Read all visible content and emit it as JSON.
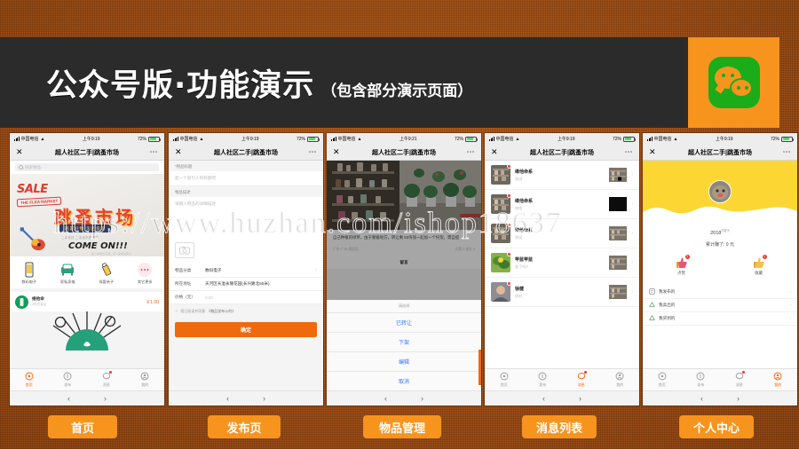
{
  "header": {
    "title": "公众号版·功能演示",
    "subtitle": "（包含部分演示页面）",
    "logo_icon": "wechat-logo-icon"
  },
  "watermark": {
    "text": "https://www.huzhan.com/ishop18637"
  },
  "statusbar": {
    "carrier": "中国电信",
    "wifi_icon": "wifi-icon",
    "time": "上午9:19",
    "time_alt": "上午9:21",
    "battery_pct": "72%"
  },
  "navbar": {
    "title": "超人社区二手|跳蚤市场",
    "close_icon": "close-icon",
    "more_icon": "more-dots-icon"
  },
  "tabbar": {
    "items": [
      {
        "label": "首页",
        "icon": "home-icon"
      },
      {
        "label": "发布",
        "icon": "publish-icon"
      },
      {
        "label": "消息",
        "icon": "message-icon"
      },
      {
        "label": "我的",
        "icon": "profile-icon"
      }
    ]
  },
  "wxbar": {
    "back_icon": "chevron-left-icon",
    "forward_icon": "chevron-right-icon"
  },
  "phone1": {
    "search_placeholder": "搜索物品",
    "search_icon": "search-icon",
    "banner": {
      "sale": "SALE",
      "flea": "THE FLEA MARKET",
      "cn_title": "跳蚤市场",
      "cn_sub": "闲置好物 淘回家吧",
      "small_note": "二手也好 二手也不要紧吧",
      "come_on": "COME ON!!!",
      "bottom_note": "废了的成色不错，有个充电说明书"
    },
    "categories": [
      {
        "label": "数码电子",
        "icon": "phone-icon"
      },
      {
        "label": "家私家电",
        "icon": "sofa-icon"
      },
      {
        "label": "母婴亲子",
        "icon": "bottle-icon"
      },
      {
        "label": "其它更多",
        "icon": "more-icon"
      }
    ],
    "product": {
      "name": "维他命",
      "desc": "2件已卖出",
      "price": "￥1.00"
    }
  },
  "phone2": {
    "title_label": "*物品标题",
    "title_placeholder": "起一个吸引人的标题吧",
    "desc_label": "物品描述",
    "desc_placeholder": "请输入物品的详细描述",
    "photo_icon": "camera-icon",
    "rows": [
      {
        "key": "物品分类",
        "value": "数码电子",
        "chevron": "chevron-right-icon"
      },
      {
        "key": "所在地址",
        "value": "天河区长湴永隆花园(长兴路北50米)",
        "chevron": "chevron-right-icon"
      },
      {
        "key": "价格（元）",
        "value": "0.00",
        "chevron": ""
      }
    ],
    "agree_tick": "check-icon",
    "agree_text": "我已阅读并同意",
    "agree_link": "《物品发布公约》",
    "submit": "确定"
  },
  "phone3": {
    "post_text": "自己种植的绿草，由于要搬地方，转让剩 50块钱一起加一个托架，需自提",
    "meta_left": "广东·广州 奥园区",
    "meta_right": "点赞 2  留言 3",
    "sheet": {
      "behind_title": "留言",
      "head": "请选择",
      "options": [
        "已转让",
        "下架",
        "编辑",
        "取消"
      ]
    }
  },
  "phone4": {
    "messages": [
      {
        "name": "维他命系",
        "preview": "测试",
        "avatar": "avatar-shelf",
        "thumb": "thumb-shelf"
      },
      {
        "name": "维他命系",
        "preview": "哈哈",
        "avatar": "avatar-shelf",
        "thumb": "thumb-dark"
      },
      {
        "name": "维他命系",
        "preview": "测试",
        "avatar": "avatar-shelf",
        "thumb": "thumb-shelf"
      },
      {
        "name": "苹蓝苹蓝",
        "preview": "卖了吗?",
        "avatar": "avatar-plant",
        "thumb": "thumb-shelf"
      },
      {
        "name": "徐健",
        "preview": "你好",
        "avatar": "avatar-person",
        "thumb": "thumb-shelf"
      }
    ]
  },
  "phone5": {
    "name": "2018",
    "name_sup": "的夏天",
    "earned": "累计赚了: 0 元",
    "actions": [
      {
        "label": "点赞",
        "badge": "3",
        "icon": "thumbs-up-icon"
      },
      {
        "label": "收藏",
        "badge": "1",
        "icon": "star-icon"
      }
    ],
    "menu": [
      {
        "label": "我发布的",
        "icon": "doc-icon"
      },
      {
        "label": "我卖出的",
        "icon": "sold-icon"
      },
      {
        "label": "我买到的",
        "icon": "bought-icon"
      }
    ]
  },
  "labels": [
    "首页",
    "发布页",
    "物品管理",
    "消息列表",
    "个人中心"
  ],
  "colors": {
    "background": "#a9500f",
    "header_band": "#2b2b2b",
    "accent_orange": "#f7941e",
    "button_orange": "#ef6a0d",
    "wechat_green": "#1aad19",
    "banner_yellow": "#fcd733",
    "link_blue": "#3478f6"
  }
}
